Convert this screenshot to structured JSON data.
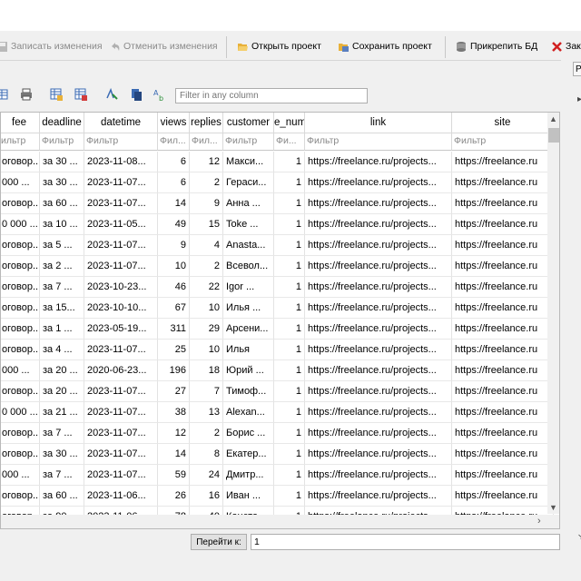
{
  "toolbar": {
    "write_changes": "Записать изменения",
    "revert_changes": "Отменить изменения",
    "open_project": "Открыть проект",
    "save_project": "Сохранить проект",
    "attach_db": "Прикрепить БД",
    "close_db": "Закр"
  },
  "side": {
    "tab_label": "P"
  },
  "filter": {
    "placeholder": "Filter in any column"
  },
  "table": {
    "columns": [
      "fee",
      "deadline",
      "datetime",
      "views",
      "replies",
      "customer",
      "e_num",
      "link",
      "site"
    ],
    "filter_placeholders": [
      "ильтр",
      "Фильтр",
      "Фильтр",
      "Фил...",
      "Фил...",
      "Фильтр",
      "Фи...",
      "Фильтр",
      "Фильтр"
    ],
    "rows": [
      [
        "оговор...",
        "за 30 ...",
        "2023-11-08...",
        "6",
        "12",
        "Макси...",
        "1",
        "https://freelance.ru/projects...",
        "https://freelance.ru"
      ],
      [
        " 000 ...",
        "за 30 ...",
        "2023-11-07...",
        "6",
        "2",
        "Гераси...",
        "1",
        "https://freelance.ru/projects...",
        "https://freelance.ru"
      ],
      [
        "оговор...",
        "за 60 ...",
        "2023-11-07...",
        "14",
        "9",
        "Анна ...",
        "1",
        "https://freelance.ru/projects...",
        "https://freelance.ru"
      ],
      [
        "0 000 ...",
        "за 10 ...",
        "2023-11-05...",
        "49",
        "15",
        "Toke ...",
        "1",
        "https://freelance.ru/projects...",
        "https://freelance.ru"
      ],
      [
        "оговор...",
        "за 5 ...",
        "2023-11-07...",
        "9",
        "4",
        "Anasta...",
        "1",
        "https://freelance.ru/projects...",
        "https://freelance.ru"
      ],
      [
        "оговор...",
        "за 2 ...",
        "2023-11-07...",
        "10",
        "2",
        "Всевол...",
        "1",
        "https://freelance.ru/projects...",
        "https://freelance.ru"
      ],
      [
        "оговор...",
        "за 7 ...",
        "2023-10-23...",
        "46",
        "22",
        "Igor ...",
        "1",
        "https://freelance.ru/projects...",
        "https://freelance.ru"
      ],
      [
        "оговор...",
        "за 15...",
        "2023-10-10...",
        "67",
        "10",
        "Илья ...",
        "1",
        "https://freelance.ru/projects...",
        "https://freelance.ru"
      ],
      [
        "оговор...",
        "за 1 ...",
        "2023-05-19...",
        "311",
        "29",
        "Арсени...",
        "1",
        "https://freelance.ru/projects...",
        "https://freelance.ru"
      ],
      [
        "оговор...",
        "за 4 ...",
        "2023-11-07...",
        "25",
        "10",
        "Илья",
        "1",
        "https://freelance.ru/projects...",
        "https://freelance.ru"
      ],
      [
        " 000 ...",
        "за 20 ...",
        "2020-06-23...",
        "196",
        "18",
        "Юрий ...",
        "1",
        "https://freelance.ru/projects...",
        "https://freelance.ru"
      ],
      [
        "оговор...",
        "за 20 ...",
        "2023-11-07...",
        "27",
        "7",
        "Тимоф...",
        "1",
        "https://freelance.ru/projects...",
        "https://freelance.ru"
      ],
      [
        "0 000 ...",
        "за 21 ...",
        "2023-11-07...",
        "38",
        "13",
        "Alexan...",
        "1",
        "https://freelance.ru/projects...",
        "https://freelance.ru"
      ],
      [
        "оговор...",
        "за 7 ...",
        "2023-11-07...",
        "12",
        "2",
        "Борис ...",
        "1",
        "https://freelance.ru/projects...",
        "https://freelance.ru"
      ],
      [
        "оговор...",
        "за 30 ...",
        "2023-11-07...",
        "14",
        "8",
        "Екатер...",
        "1",
        "https://freelance.ru/projects...",
        "https://freelance.ru"
      ],
      [
        " 000 ...",
        "за 7 ...",
        "2023-11-07...",
        "59",
        "24",
        "Дмитр...",
        "1",
        "https://freelance.ru/projects...",
        "https://freelance.ru"
      ],
      [
        "оговор...",
        "за 60 ...",
        "2023-11-06...",
        "26",
        "16",
        "Иван ...",
        "1",
        "https://freelance.ru/projects...",
        "https://freelance.ru"
      ],
      [
        "оговор...",
        "за 90 ...",
        "2023-11-06...",
        "78",
        "40",
        "Конста...",
        "1",
        "https://freelance.ru/projects...",
        "https://freelance.ru"
      ]
    ]
  },
  "goto": {
    "label": "Перейти к:",
    "value": "1"
  },
  "icons": [
    "disk-icon",
    "undo-icon",
    "folder-open-icon",
    "save-project-icon",
    "db-attach-icon",
    "close-x-icon",
    "print-icon",
    "table-icon",
    "delete-table-icon",
    "sort-icon",
    "copy-icon",
    "find-replace-icon",
    "scroll-up-icon",
    "scroll-down-icon",
    "scroll-right-icon"
  ],
  "colors": {
    "close_x": "#d11f1f",
    "folder": "#e8b13a",
    "grid_border": "#b9b9b9"
  }
}
